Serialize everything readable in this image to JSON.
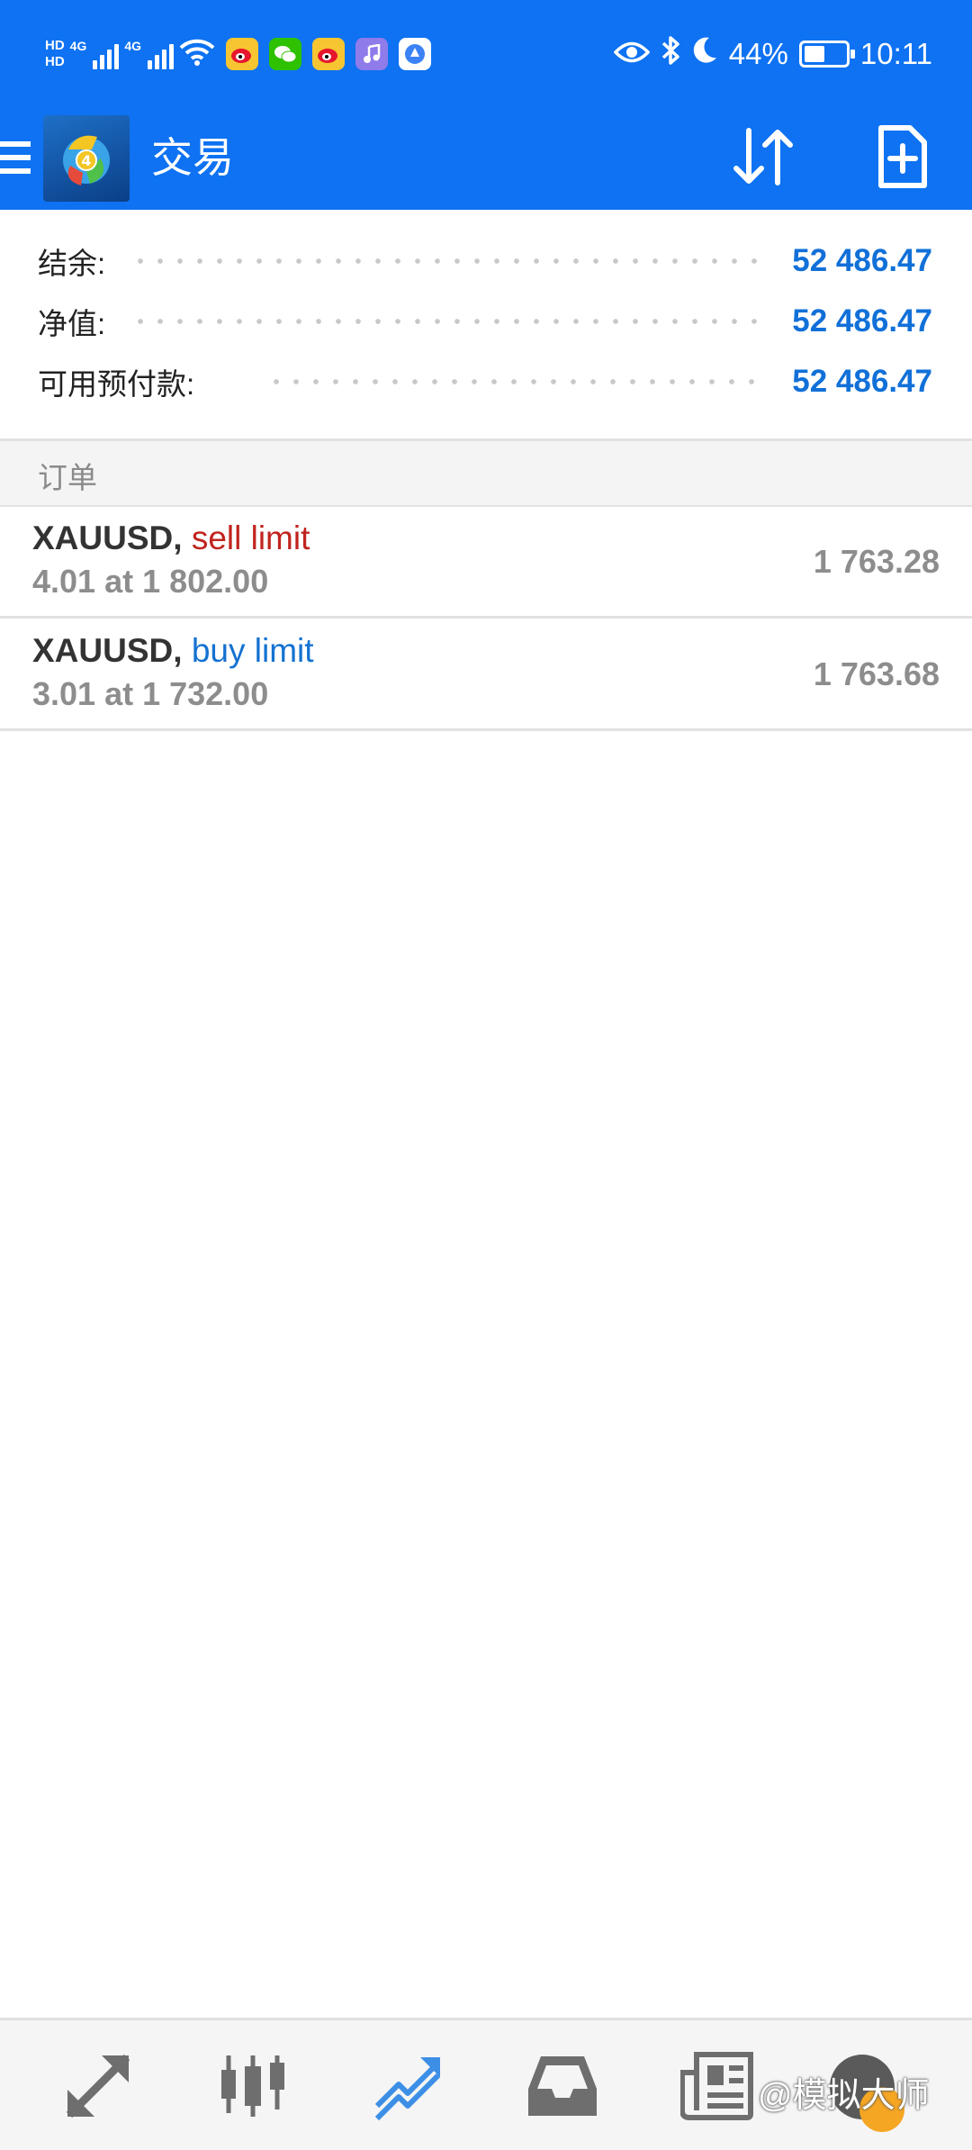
{
  "status_bar": {
    "network_1": "HD",
    "network_2": "HD",
    "signal_1": "4G",
    "signal_2": "4G",
    "battery": "44%",
    "battery_level": 0.44,
    "time": "10:11"
  },
  "app_bar": {
    "title": "交易"
  },
  "summary": {
    "balance_label": "结余:",
    "balance_value": "52 486.47",
    "equity_label": "净值:",
    "equity_value": "52 486.47",
    "free_margin_label": "可用预付款:",
    "free_margin_value": "52 486.47"
  },
  "orders_section": {
    "title": "订单",
    "orders": [
      {
        "symbol": "XAUUSD,",
        "type": "sell limit",
        "detail": "4.01 at 1 802.00",
        "price": "1 763.28"
      },
      {
        "symbol": "XAUUSD,",
        "type": "buy limit",
        "detail": "3.01 at 1 732.00",
        "price": "1 763.68"
      }
    ]
  },
  "bottom_nav": {
    "items": [
      "quotes-icon",
      "chart-icon",
      "trade-icon",
      "history-icon",
      "news-icon"
    ],
    "active": "trade-icon",
    "active_color": "#3d8fe6"
  },
  "watermark": "@模拟大师",
  "colors": {
    "primary": "#0e72f2",
    "value_blue": "#1170d8",
    "sell_red": "#c0241e",
    "buy_blue": "#1472d1"
  }
}
